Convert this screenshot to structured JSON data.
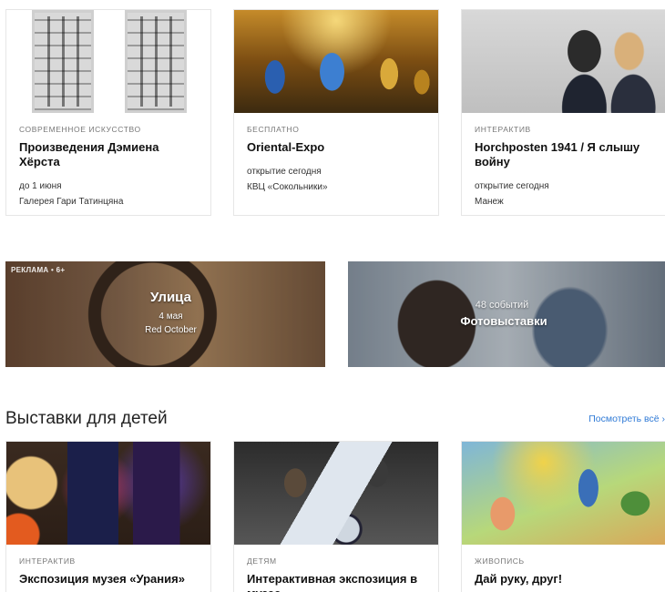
{
  "row1": [
    {
      "category": "СОВРЕМЕННОЕ ИСКУССТВО",
      "title": "Произведения Дэмиена Хёрста",
      "date": "до 1 июня",
      "place": "Галерея Гари Татинцяна"
    },
    {
      "category": "БЕСПЛАТНО",
      "title": "Oriental-Expo",
      "date": "открытие сегодня",
      "place": "КВЦ «Сокольники»"
    },
    {
      "category": "ИНТЕРАКТИВ",
      "title": "Horchposten 1941 / Я слышу войну",
      "date": "открытие сегодня",
      "place": "Манеж"
    }
  ],
  "banners": {
    "left": {
      "ad_label": "РЕКЛАМА • 6+",
      "title": "Улица",
      "date": "4 мая",
      "place": "Red October"
    },
    "right": {
      "count": "48 событий",
      "title": "Фотовыставки"
    }
  },
  "section": {
    "title": "Выставки для детей",
    "see_all": "Посмотреть всё ›"
  },
  "row2": [
    {
      "category": "ИНТЕРАКТИВ",
      "title": "Экспозиция музея «Урания»"
    },
    {
      "category": "ДЕТЯМ",
      "title": "Интерактивная экспозиция в музее"
    },
    {
      "category": "ЖИВОПИСЬ",
      "title": "Дай руку, друг!"
    }
  ]
}
